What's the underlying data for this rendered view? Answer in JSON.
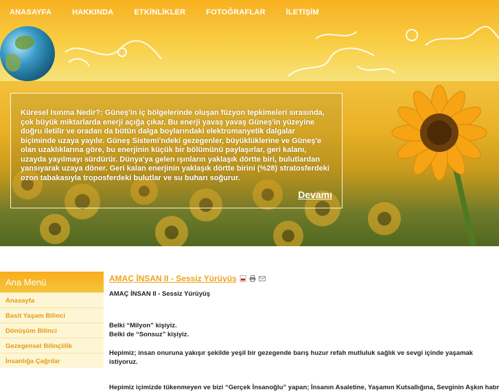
{
  "nav": {
    "items": [
      "ANASAYFA",
      "HAKKINDA",
      "ETKİNLİKLER",
      "FOTOĞRAFLAR",
      "İLETİŞİM"
    ]
  },
  "intro": {
    "text": "Küresel Isınma Nedir?: Güneş'in iç bölgelerinde oluşan füzyon tepkimeleri sırasında, çok büyük miktarlarda enerji açığa çıkar. Bu enerji yavaş yavaş Güneş'in yüzeyine doğru iletilir ve oradan da bütün dalga boylarındaki elektromanyetik dalgalar biçiminde uzaya yayılır. Güneş Sistemi'ndeki gezegenler, büyüklüklerine ve Güneş'e olan uzaklıklarına göre, bu enerjinin küçük bir bölümünü paylaşırlar, geri kalanı, uzayda yayılmayı sürdürür. Dünya'ya gelen ışınların yaklaşık dörtte biri, bulutlardan yansıyarak uzaya döner. Geri kalan enerjinin yaklaşık dörtte birini (%28) stratosferdeki ozon tabakasıyla troposferdeki bulutlar ve su buharı soğurur.",
    "more_label": "Devamı"
  },
  "sidebar": {
    "heading": "Ana Menü",
    "items": [
      {
        "label": "Anasayfa"
      },
      {
        "label": "Basit Yaşam Bilinci"
      },
      {
        "label": "Dönüşüm Bilinci"
      },
      {
        "label": "Gezegensel Bilinçlilik"
      },
      {
        "label": "İnsanlığa Çağrılar"
      }
    ]
  },
  "article": {
    "title": "AMAÇ İNSAN II - Sessiz Yürüyüş",
    "subtitle": "AMAÇ İNSAN II - Sessiz Yürüyüş",
    "lines": {
      "l1": "Belki “Milyon” kişiyiz.",
      "l2": "Belki de “Sonsuz” kişiyiz.",
      "l3": "Hepimiz; insan onuruna yakışır şekilde yeşil bir gezegende barış huzur refah mutluluk sağlık ve sevgi içinde yaşamak istiyoruz.",
      "l4": "Hepimiz içimizde tükenmeyen ve bizi “Gerçek İnsanoğlu” yapan; İnsanın Asaletine, Yaşamın Kutsallığına, Sevginin Aşkın hatırına"
    },
    "icons": [
      "pdf-icon",
      "print-icon",
      "email-icon"
    ]
  },
  "colors": {
    "accent": "#f0a31d",
    "nav_bg": "#f9b21e",
    "sidebar_bg": "#fdf6d5",
    "sidebar_text": "#e59a17"
  }
}
